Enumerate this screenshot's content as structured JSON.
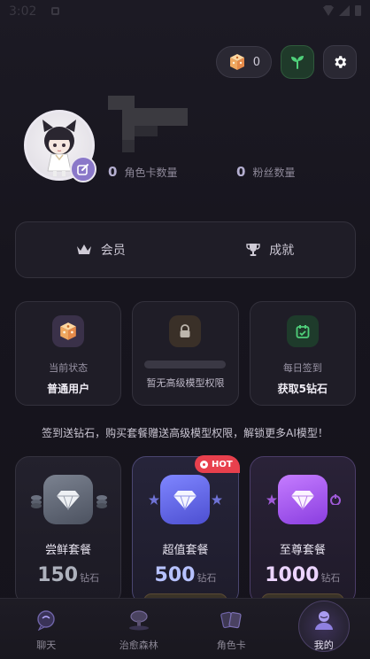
{
  "status_bar": {
    "time": "3:02"
  },
  "header": {
    "coin_count": "0"
  },
  "profile": {
    "stats": [
      {
        "value": "0",
        "label": "角色卡数量"
      },
      {
        "value": "0",
        "label": "粉丝数量"
      }
    ]
  },
  "membership": {
    "vip_label": "会员",
    "achievement_label": "成就"
  },
  "features": [
    {
      "sub": "当前状态",
      "main": "普通用户"
    },
    {
      "sub": "暂无高级模型权限"
    },
    {
      "sub": "每日签到",
      "main": "获取5钻石"
    }
  ],
  "promo_text": "签到送钻石，购买套餐赠送高级模型权限，解锁更多AI模型！",
  "packages": [
    {
      "name": "尝鲜套餐",
      "amount": "150",
      "unit": "钻石"
    },
    {
      "name": "超值套餐",
      "amount": "500",
      "unit": "钻石",
      "badge": "HOT"
    },
    {
      "name": "至尊套餐",
      "amount": "1000",
      "unit": "钻石"
    }
  ],
  "nav": [
    {
      "label": "聊天",
      "icon": "chat-icon"
    },
    {
      "label": "治愈森林",
      "icon": "forest-icon"
    },
    {
      "label": "角色卡",
      "icon": "cards-icon"
    },
    {
      "label": "我的",
      "icon": "profile-icon",
      "active": true
    }
  ],
  "colors": {
    "background": "#17151e",
    "accent_purple": "#8a78c9",
    "hot_red": "#e8404d",
    "card_bg": "#1f1d27"
  }
}
